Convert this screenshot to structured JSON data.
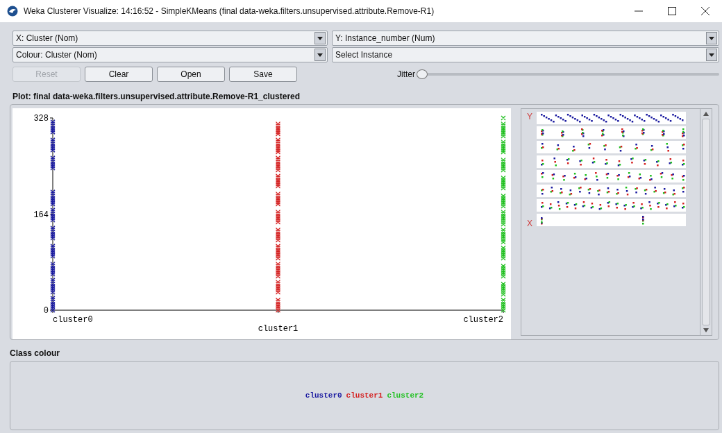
{
  "window": {
    "title": "Weka Clusterer Visualize: 14:16:52 - SimpleKMeans (final data-weka.filters.unsupervised.attribute.Remove-R1)"
  },
  "selectors": [
    {
      "value": "X: Cluster (Nom)"
    },
    {
      "value": "Y: Instance_number (Num)"
    },
    {
      "value": "Colour: Cluster (Nom)"
    },
    {
      "value": "Select Instance"
    }
  ],
  "buttons": [
    {
      "label": "Reset",
      "disabled": true
    },
    {
      "label": "Clear",
      "disabled": false
    },
    {
      "label": "Open",
      "disabled": false
    },
    {
      "label": "Save",
      "disabled": false
    }
  ],
  "jitter": {
    "label": "Jitter",
    "level": 0
  },
  "plot": {
    "title": "Plot: final data-weka.filters.unsupervised.attribute.Remove-R1_clustered",
    "y_axis_labels": [
      "328",
      "164",
      "0"
    ],
    "x_axis_labels": [
      "cluster0",
      "cluster1",
      "cluster2"
    ]
  },
  "matrix": {
    "y_label": "Y",
    "x_label": "X"
  },
  "class_colour": {
    "title": "Class colour",
    "items": [
      {
        "label": "cluster0",
        "color": "#1a1aa0"
      },
      {
        "label": "cluster1",
        "color": "#d42020"
      },
      {
        "label": "cluster2",
        "color": "#20c020"
      }
    ]
  }
}
